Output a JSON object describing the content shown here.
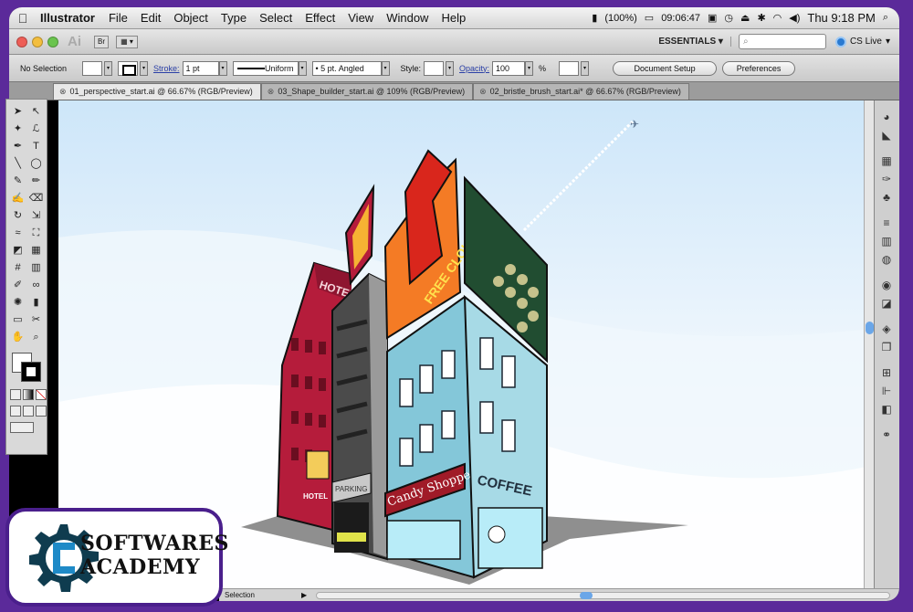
{
  "menubar": {
    "apple": "",
    "app_name": "Illustrator",
    "items": [
      "File",
      "Edit",
      "Object",
      "Type",
      "Select",
      "Effect",
      "View",
      "Window",
      "Help"
    ],
    "battery": "(100%)",
    "timer": "09:06:47",
    "clock": "Thu 9:18 PM"
  },
  "appbar": {
    "logo": "Ai",
    "bridge": "Br",
    "workspace": "ESSENTIALS",
    "search_placeholder": "",
    "cs_live": "CS Live"
  },
  "control": {
    "selection": "No Selection",
    "stroke_label": "Stroke:",
    "stroke_weight": "1 pt",
    "profile": "Uniform",
    "brush": "5 pt. Angled",
    "style_label": "Style:",
    "opacity_label": "Opacity:",
    "opacity_value": "100",
    "percent": "%",
    "doc_setup": "Document Setup",
    "preferences": "Preferences"
  },
  "tabs": [
    {
      "label": "01_perspective_start.ai @ 66.67% (RGB/Preview)",
      "active": true
    },
    {
      "label": "03_Shape_builder_start.ai @ 109% (RGB/Preview)",
      "active": false
    },
    {
      "label": "02_bristle_brush_start.ai* @ 66.67% (RGB/Preview)",
      "active": false
    }
  ],
  "tool_icons": [
    "selection-tool-icon",
    "direct-selection-tool-icon",
    "magic-wand-icon",
    "lasso-icon",
    "pen-tool-icon",
    "type-tool-icon",
    "line-tool-icon",
    "ellipse-tool-icon",
    "paintbrush-icon",
    "pencil-icon",
    "blob-brush-icon",
    "eraser-icon",
    "rotate-icon",
    "scale-icon",
    "width-tool-icon",
    "free-transform-icon",
    "shape-builder-icon",
    "perspective-grid-icon",
    "mesh-icon",
    "gradient-icon",
    "eyedropper-icon",
    "blend-icon",
    "symbol-sprayer-icon",
    "graph-icon",
    "artboard-icon",
    "slice-icon",
    "hand-icon",
    "zoom-icon"
  ],
  "tool_glyphs": [
    "➤",
    "↖",
    "✦",
    "ℒ",
    "✒",
    "T",
    "╲",
    "◯",
    "✎",
    "✏",
    "✍",
    "⌫",
    "↻",
    "⇲",
    "≈",
    "⛶",
    "◩",
    "▦",
    "#",
    "▥",
    "✐",
    "∞",
    "✺",
    "▮",
    "▭",
    "✂",
    "✋",
    "⌕"
  ],
  "artwork": {
    "hotel_sign": "HOTEL",
    "hotel_small": "HOTEL",
    "parking": "PARKING",
    "billboard": "FREE CLOUD",
    "candy_shop": "Candy Shoppe",
    "coffee": "COFFEE"
  },
  "statusbar": {
    "tool": "Selection"
  },
  "logo": {
    "line1": "SOFTWARES",
    "line2": "ACADEMY"
  }
}
